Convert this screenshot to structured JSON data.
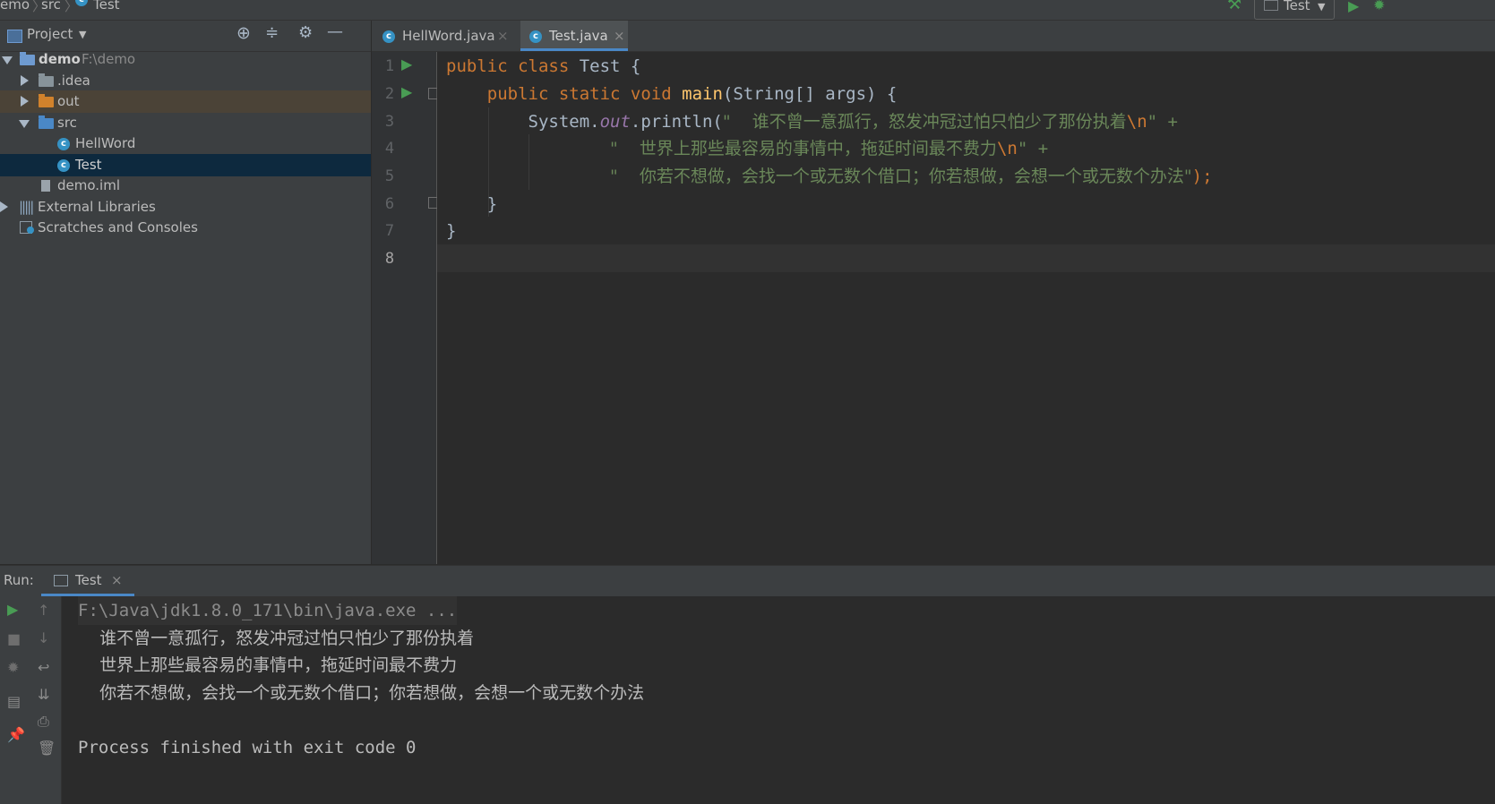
{
  "breadcrumb": {
    "items": [
      "emo",
      "src",
      "Test"
    ],
    "run_config": "Test"
  },
  "project": {
    "header": "Project",
    "tree": [
      {
        "label": "demo",
        "sub": "F:\\demo",
        "type": "module",
        "expanded": true
      },
      {
        "label": ".idea",
        "type": "folder"
      },
      {
        "label": "out",
        "type": "folder-out"
      },
      {
        "label": "src",
        "type": "folder-src",
        "expanded": true
      },
      {
        "label": "HellWord",
        "type": "class"
      },
      {
        "label": "Test",
        "type": "class",
        "selected": true
      },
      {
        "label": "demo.iml",
        "type": "file"
      },
      {
        "label": "External Libraries",
        "type": "lib"
      },
      {
        "label": "Scratches and Consoles",
        "type": "scratch"
      }
    ]
  },
  "editor": {
    "tabs": [
      {
        "label": "HellWord.java",
        "active": false
      },
      {
        "label": "Test.java",
        "active": true
      }
    ],
    "line_numbers": [
      "1",
      "2",
      "3",
      "4",
      "5",
      "6",
      "7",
      "8"
    ],
    "code": {
      "l1_kw": "public class",
      "l1_rest": " Test {",
      "l2_kw": "public static void",
      "l2_fn": "main",
      "l2_rest": "(String[] args) {",
      "l3_a": "System.",
      "l3_out": "out",
      "l3_b": ".println(",
      "l3_str": "\"    谁不曾一意孤行，怒发冲冠过怕只怕少了那份执着",
      "l3_esc": "\\n",
      "l3_end": "\" +",
      "l4_str": "\"    世界上那些最容易的事情中，拖延时间最不费力",
      "l4_esc": "\\n",
      "l4_end": "\" +",
      "l5_str": "\"    你若不想做，会找一个或无数个借口；你若想做，会想一个或无数个办法\"",
      "l5_end": ");",
      "l6": "}",
      "l7": "}"
    }
  },
  "run": {
    "label": "Run:",
    "tab": "Test",
    "console": [
      "F:\\Java\\jdk1.8.0_171\\bin\\java.exe ...",
      "    谁不曾一意孤行，怒发冲冠过怕只怕少了那份执着",
      "    世界上那些最容易的事情中，拖延时间最不费力",
      "    你若不想做，会找一个或无数个借口；你若想做，会想一个或无数个办法",
      "",
      "Process finished with exit code 0"
    ]
  },
  "colors": {
    "accent": "#4a88c7",
    "run_green": "#499c54",
    "selection": "#0d293e"
  }
}
